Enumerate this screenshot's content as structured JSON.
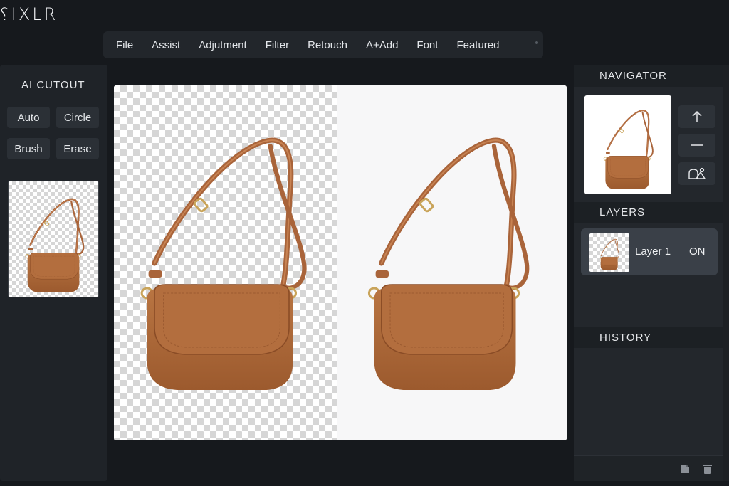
{
  "app": {
    "logo": "⸮IXLR"
  },
  "menu": [
    "File",
    "Assist",
    "Adjutment",
    "Filter",
    "Retouch",
    "A+Add",
    "Font",
    "Featured"
  ],
  "left_panel": {
    "title": "AI CUTOUT",
    "buttons": [
      "Auto",
      "Circle",
      "Brush",
      "Erase"
    ]
  },
  "right_panel": {
    "navigator_title": "NAVIGATOR",
    "layers_title": "LAYERS",
    "history_title": "HISTORY",
    "layer": {
      "name": "Layer 1",
      "visibility": "ON"
    },
    "nav_icons": [
      "arrow-up-icon",
      "minus-icon",
      "shapes-icon"
    ],
    "footer_icons": [
      "new-layer-icon",
      "trash-icon"
    ]
  },
  "colors": {
    "background": "#16191d",
    "panel": "#23272c",
    "bag_leather": "#b1693a",
    "bag_dark": "#8a4c26",
    "hardware_gold": "#c9a45a"
  }
}
